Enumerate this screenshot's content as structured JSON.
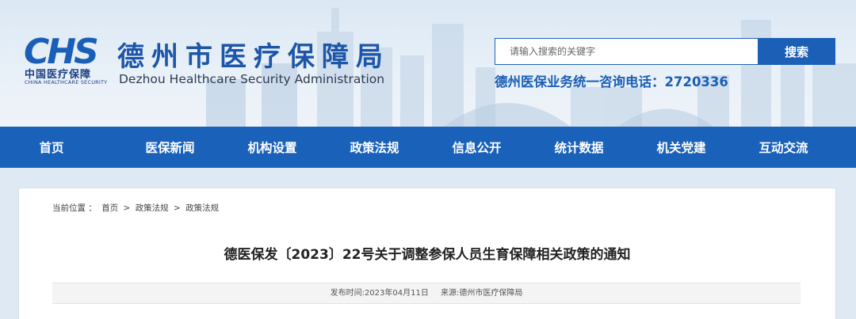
{
  "header": {
    "logo_text": "CHS",
    "logo_cn": "中国医疗保障",
    "logo_en": "CHINA HEALTHCARE SECURITY",
    "site_title": "德州市医疗保障局",
    "site_title_en": "Dezhou Healthcare Security Administration",
    "search": {
      "placeholder": "请输入搜索的关键字",
      "button_label": "搜索"
    },
    "hotline": "德州医保业务统一咨询电话：2720336"
  },
  "nav": {
    "items": [
      {
        "label": "首页"
      },
      {
        "label": "医保新闻"
      },
      {
        "label": "机构设置"
      },
      {
        "label": "政策法规"
      },
      {
        "label": "信息公开"
      },
      {
        "label": "统计数据"
      },
      {
        "label": "机关党建"
      },
      {
        "label": "互动交流"
      }
    ]
  },
  "breadcrumb": {
    "prefix": "当前位置 ：",
    "items": [
      "首页",
      ">",
      "政策法规",
      ">",
      "政策法规"
    ]
  },
  "article": {
    "title": "德医保发〔2023〕22号关于调整参保人员生育保障相关政策的通知",
    "publish_time": "发布时间:2023年04月11日",
    "source": "来源:德州市医疗保障局"
  },
  "colors": {
    "brand_blue": "#1a62b9",
    "title_blue": "#1d56a8",
    "logo_navy": "#1d3f84"
  }
}
